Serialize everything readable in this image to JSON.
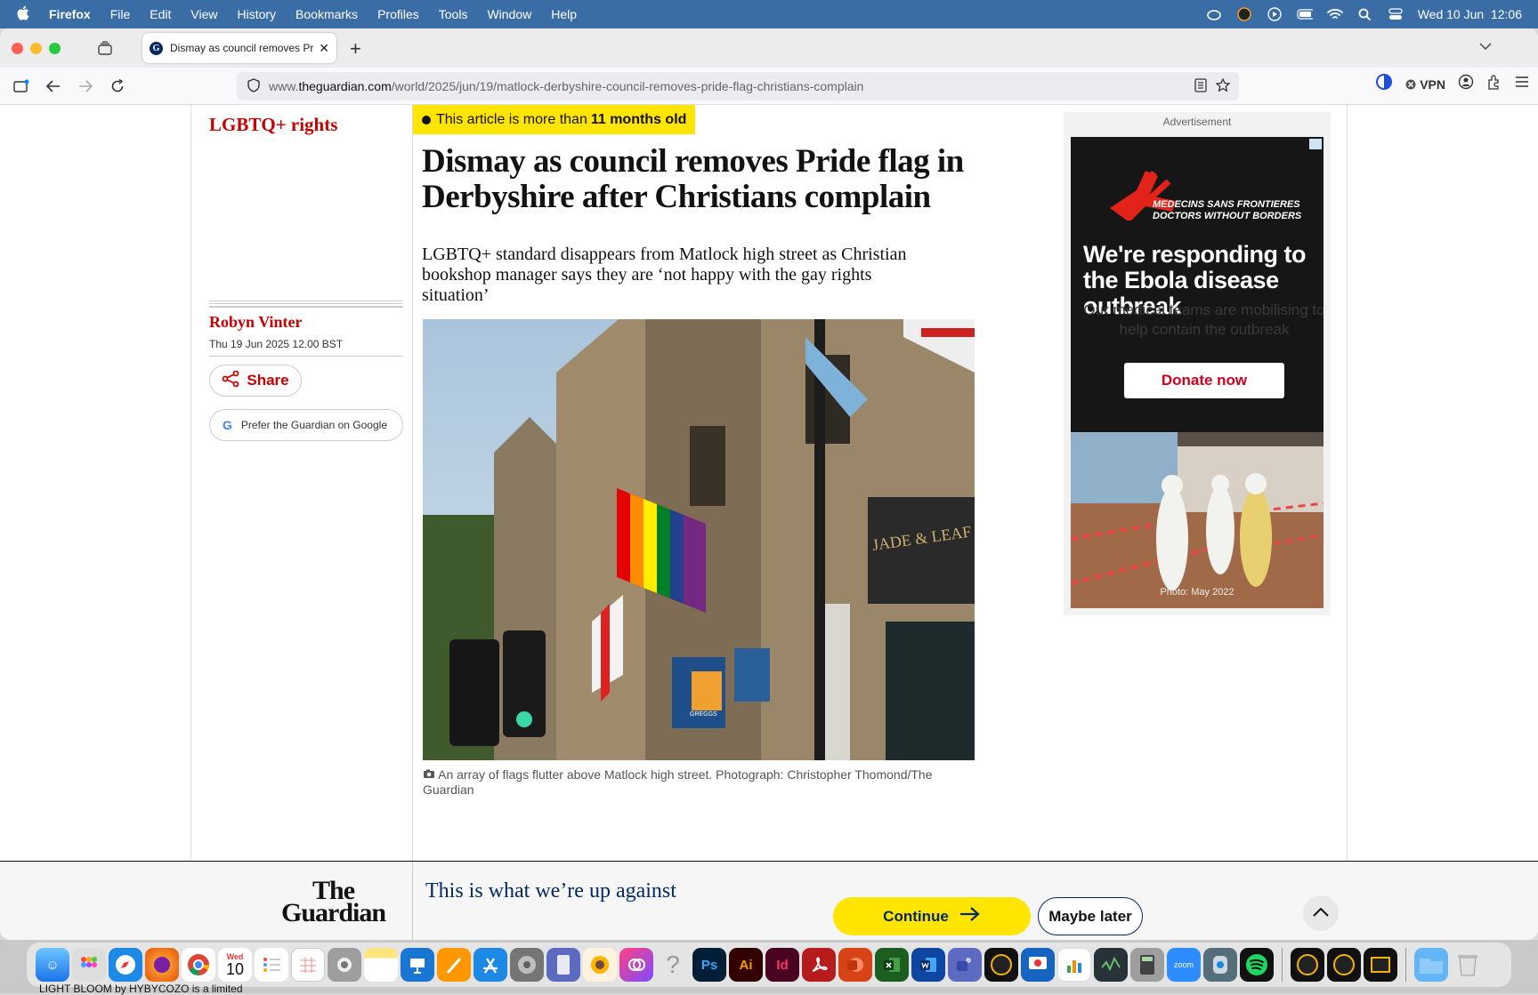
{
  "menubar": {
    "app": "Firefox",
    "items": [
      "File",
      "Edit",
      "View",
      "History",
      "Bookmarks",
      "Profiles",
      "Tools",
      "Window",
      "Help"
    ],
    "clock": "Wed 10 Jun  12:06"
  },
  "tab": {
    "title": "Dismay as council removes Prid",
    "favicon": "G"
  },
  "url": {
    "prefix": "www.",
    "domain": "theguardian.com",
    "path": "/world/2025/jun/19/matlock-derbyshire-council-removes-pride-flag-christians-complain"
  },
  "toolbar": {
    "vpn_label": "VPN"
  },
  "article": {
    "section": "LGBTQ+ rights",
    "age_prefix": "This article is more than",
    "age_value": "11 months old",
    "headline": "Dismay as council removes Pride flag in Derbyshire after Christians complain",
    "standfirst": "LGBTQ+ standard disappears from Matlock high street as Christian bookshop manager says they are ‘not happy with the gay rights situation’",
    "author": "Robyn Vinter",
    "date": "Thu 19 Jun 2025 12.00 BST",
    "share_label": "Share",
    "google_label": "Prefer the Guardian on Google",
    "caption": "An array of flags flutter above Matlock high street. Photograph: Christopher Thomond/The Guardian",
    "photo_signs": {
      "greggs": "GREGGS",
      "shop": "JADE & LEAF"
    }
  },
  "ad": {
    "label": "Advertisement",
    "org_line1": "MEDECINS SANS FRONTIERES",
    "org_line2": "DOCTORS WITHOUT BORDERS",
    "headline": "We're responding to the Ebola disease outbreak",
    "subline": "Our medical teams are mobilising to help contain the outbreak",
    "cta": "Donate now",
    "photo_caption": "Photo: May 2022"
  },
  "support": {
    "logo_line1": "The",
    "logo_line2": "Guardian",
    "message": "This is what we’re up against",
    "continue_label": "Continue",
    "later_label": "Maybe later"
  },
  "dock": {
    "calendar_month": "Wed",
    "calendar_day": "10",
    "zoom_label": "zoom",
    "apps": [
      "Ps",
      "Ai",
      "Id"
    ]
  },
  "bottom_text": "LIGHT BLOOM by HYBYCOZO is a limited"
}
